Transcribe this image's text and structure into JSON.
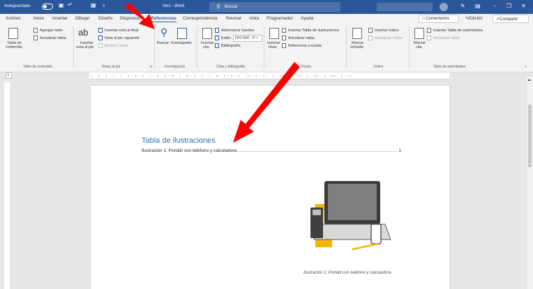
{
  "titlebar": {
    "autosave": "Autoguardado",
    "doc_title": "nto1 - Word",
    "search_placeholder": "Buscar"
  },
  "tabs": [
    "Archivo",
    "Inicio",
    "Insertar",
    "Dibujar",
    "Diseño",
    "Disposición",
    "Referencias",
    "Correspondencia",
    "Revisar",
    "Vista",
    "Programador",
    "Ayuda"
  ],
  "active_tab": "Referencias",
  "tab_actions": {
    "comments": "Comentarios",
    "editing": "Edición",
    "share": "Compartir"
  },
  "ribbon": {
    "toc": {
      "table_of_contents": "Tabla de",
      "table_of_contents_2": "contenido",
      "add_text": "Agregar texto",
      "update_table": "Actualizar tabla",
      "label": "Tabla de contenido"
    },
    "footnotes": {
      "insert_footnote_big": "ab",
      "insert_footnote": "Insertar",
      "insert_footnote_2": "nota al pie",
      "insert_endnote": "Insertar nota al final",
      "next_footnote": "Nota al pie siguiente",
      "show_notes": "Mostrar notas",
      "label": "Notas al pie"
    },
    "research": {
      "search": "Buscar",
      "researcher": "Investigador",
      "label": "Investigación"
    },
    "citations": {
      "insert_citation": "Insertar",
      "insert_citation_2": "cita",
      "manage_sources": "Administrar fuentes",
      "style_label": "Estilo:",
      "style_value": "ISO 690 - P",
      "bibliography": "Bibliografía",
      "label": "Citas y bibliografía"
    },
    "captions": {
      "insert_caption": "Insertar",
      "insert_caption_2": "título",
      "insert_table_figures": "Insertar Tabla de ilustraciones",
      "update_table": "Actualizar tabla",
      "cross_reference": "Referencia cruzada",
      "label": "Títulos"
    },
    "index": {
      "mark_entry": "Marcar",
      "mark_entry_2": "entrada",
      "insert_index": "Insertar índice",
      "update_index": "Actualizar índice",
      "label": "Índice"
    },
    "authorities": {
      "mark_citation": "Marcar",
      "mark_citation_2": "cita",
      "insert_table": "Insertar Tabla de autoridades",
      "update_table": "Actualizar tabla",
      "label": "Tabla de autoridades"
    }
  },
  "ruler": {
    "marks": "1 · 2 · 1 · 1 · 1 · 2 · 1 · 3 · 1 · 4 · 1 · 5 · 1 · 6 · 1 · 7 · 1 · 8 · 1 · 9 · 1 · 10 · 1 · 11 · 1 · 12 · 1 · 13 · 1 · 14 · 1 · 16 · 1 · 17"
  },
  "document": {
    "heading": "Tabla de ilustraciones",
    "toc_entry": "Ilustración 1: Portátil con teléfono y calculadora",
    "toc_page": "1",
    "caption": "Ilustración 1: Portátil con teléfono y calculadora"
  },
  "colors": {
    "word_blue": "#2b579a",
    "heading_blue": "#2e74b5",
    "arrow_red": "#ff0000"
  }
}
